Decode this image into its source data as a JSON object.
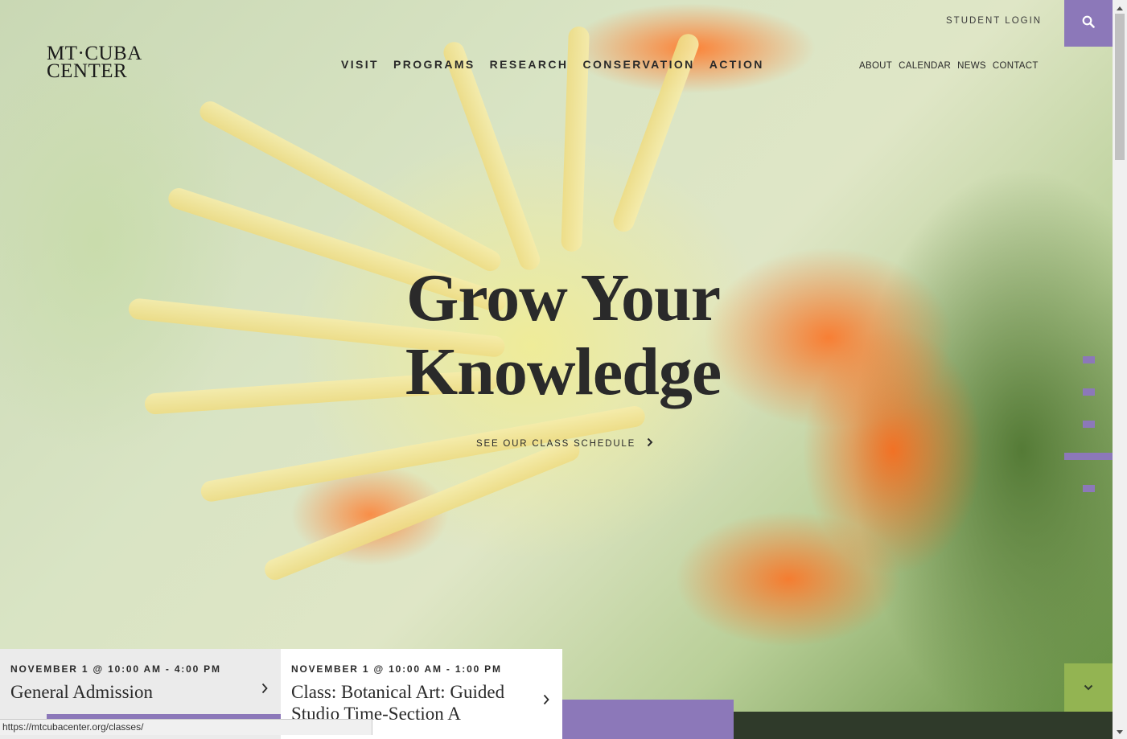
{
  "logo": {
    "line1": "MT·CUBA",
    "line2": "CENTER"
  },
  "main_nav": [
    "VISIT",
    "PROGRAMS",
    "RESEARCH",
    "CONSERVATION",
    "ACTION"
  ],
  "utility": {
    "student_login": "STUDENT LOGIN",
    "links": [
      "ABOUT",
      "CALENDAR",
      "NEWS",
      "CONTACT"
    ],
    "search_icon": "search-icon"
  },
  "hero": {
    "title_line1": "Grow Your",
    "title_line2": "Knowledge",
    "cta": "SEE OUR CLASS SCHEDULE"
  },
  "slides": {
    "count": 5,
    "active_index": 3
  },
  "events": [
    {
      "date": "NOVEMBER 1 @ 10:00 AM - 4:00 PM",
      "title": "General Admission"
    },
    {
      "date": "NOVEMBER 1 @ 10:00 AM - 1:00 PM",
      "title": "Class: Botanical Art: Guided Studio Time-Section A"
    }
  ],
  "status_bar": {
    "url": "https://mtcubacenter.org/classes/"
  },
  "colors": {
    "accent_purple": "#8c78b9",
    "accent_green": "#93b452"
  }
}
